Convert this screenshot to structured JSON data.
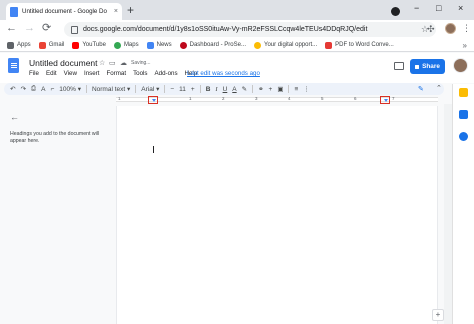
{
  "browser": {
    "tab_title": "Untitled document - Google Do",
    "tab_close": "×",
    "new_tab": "+",
    "window_controls": {
      "minimize": "−",
      "maximize": "□",
      "close": "×"
    },
    "nav": {
      "back": "←",
      "forward": "→",
      "reload": "⟳"
    },
    "url": "docs.google.com/document/d/1y8s1oSS0ituAw-Vy-mR2eFSSLCcqw4leTEUs4DDqRJQ/edit",
    "bookmarks": [
      {
        "label": "Apps",
        "color": "#5f6368"
      },
      {
        "label": "Gmail",
        "color": "#ea4335"
      },
      {
        "label": "YouTube",
        "color": "#ff0000"
      },
      {
        "label": "Maps",
        "color": "#34a853"
      },
      {
        "label": "News",
        "color": "#4285f4"
      },
      {
        "label": "Dashboard - ProSe...",
        "color": "#bd081c"
      },
      {
        "label": "Your digital opport...",
        "color": "#fbbc04"
      },
      {
        "label": "PDF to Word Conve...",
        "color": "#e53935"
      }
    ],
    "bookmarks_more": "»"
  },
  "docs": {
    "title": "Untitled document",
    "status": "Saving...",
    "menu": [
      "File",
      "Edit",
      "View",
      "Insert",
      "Format",
      "Tools",
      "Add-ons",
      "Help"
    ],
    "last_edit": "Last edit was seconds ago",
    "share_label": "Share",
    "colors": {
      "accent": "#1a73e8",
      "marker": "#d93025",
      "doc_blue": "#4285f4"
    }
  },
  "toolbar": {
    "undo": "↶",
    "redo": "↷",
    "print": "⎙",
    "spell": "A",
    "zoom": "100%",
    "style": "Normal text",
    "font": "Arial",
    "size_minus": "−",
    "size": "11",
    "size_plus": "+",
    "bold": "B",
    "italic": "I",
    "underline": "U",
    "text_color": "A",
    "link": "🔗",
    "comment": "+",
    "image": "▣",
    "align": "≡",
    "more": "⋮",
    "pen": "✎",
    "collapse": "⌃"
  },
  "ruler": {
    "numbers": [
      "1",
      "1",
      "2",
      "3",
      "4",
      "5",
      "6",
      "7"
    ]
  },
  "outline": {
    "back": "←",
    "hint": "Headings you add to the document will appear here."
  },
  "explore": "+"
}
